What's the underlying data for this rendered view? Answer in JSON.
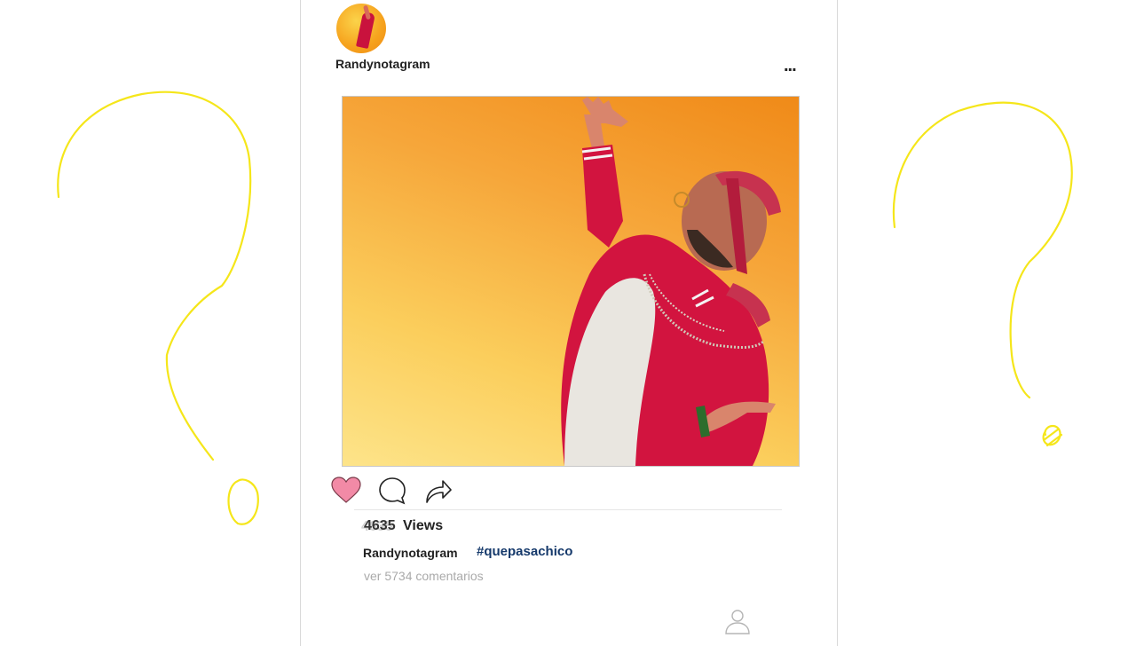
{
  "post": {
    "username": "Randynotagram",
    "more_label": "...",
    "views_count": "4635",
    "views_label": "Views",
    "caption_user": "Randynotagram",
    "hashtag": "#quepasachico",
    "comments_link": "ver 5734 comentarios"
  },
  "icons": {
    "like": "heart-icon",
    "comment": "comment-bubble-icon",
    "share": "share-arrow-icon",
    "profile": "profile-icon",
    "more": "more-options-icon"
  },
  "colors": {
    "heart_fill": "#f28aa6",
    "hashtag": "#15396b",
    "doodle": "#f5e61a",
    "photo_bg_top": "#f08a18",
    "photo_bg_bottom": "#fde48a",
    "jacket": "#d2143f"
  }
}
